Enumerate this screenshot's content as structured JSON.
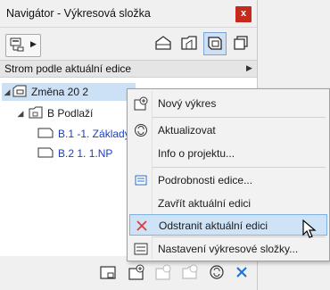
{
  "window": {
    "title": "Navigátor - Výkresová složka",
    "close_glyph": "x"
  },
  "toolbar": {
    "left_button_icon": "project-tree-icon",
    "view_buttons": [
      "project-map-icon",
      "view-map-icon",
      "layout-book-icon",
      "publisher-sets-icon"
    ],
    "active_index": 2
  },
  "combo": {
    "label": "Strom podle aktuální edice"
  },
  "tree": {
    "items": [
      {
        "label": "Změna 20 2",
        "level": 0,
        "selected": true,
        "icon": "revision-icon"
      },
      {
        "label": "B Podlaží",
        "level": 1,
        "icon": "folder-icon"
      },
      {
        "label": "B.1 -1. Základy",
        "level": 2,
        "icon": "drawing-icon"
      },
      {
        "label": "B.2 1. 1.NP",
        "level": 2,
        "icon": "drawing-icon"
      }
    ]
  },
  "menu": {
    "items": [
      {
        "label": "Nový výkres",
        "icon": "new-drawing-icon"
      },
      {
        "label": "Aktualizovat",
        "icon": "refresh-icon"
      },
      {
        "label": "Info o projektu...",
        "icon": "info-icon"
      },
      {
        "label": "Podrobnosti edice...",
        "icon": "details-icon"
      },
      {
        "label": "Zavřít aktuální edici",
        "icon": "close-issue-icon"
      },
      {
        "label": "Odstranit aktuální edici",
        "icon": "delete-icon",
        "highlighted": true
      },
      {
        "label": "Nastavení výkresové složky...",
        "icon": "settings-icon"
      }
    ]
  },
  "colors": {
    "close": "#c42b1c",
    "highlight": "#cfe3f7",
    "accent_blue": "#1a3fbf",
    "delete_red": "#e03a3a"
  }
}
